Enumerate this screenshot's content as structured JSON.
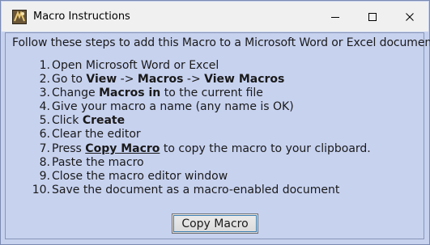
{
  "window": {
    "title": "Macro Instructions"
  },
  "instructions": {
    "intro": "Follow these steps to add this Macro to a Microsoft Word or Excel document:",
    "steps": [
      {
        "num": "1.",
        "parts": [
          {
            "t": "Open Microsoft Word or Excel"
          }
        ]
      },
      {
        "num": "2.",
        "parts": [
          {
            "t": "Go to "
          },
          {
            "t": "View",
            "b": true
          },
          {
            "t": " -> "
          },
          {
            "t": "Macros",
            "b": true
          },
          {
            "t": " -> "
          },
          {
            "t": "View Macros",
            "b": true
          }
        ]
      },
      {
        "num": "3.",
        "parts": [
          {
            "t": "Change "
          },
          {
            "t": "Macros in",
            "b": true
          },
          {
            "t": " to the current file"
          }
        ]
      },
      {
        "num": "4.",
        "parts": [
          {
            "t": "Give your macro a name (any name is OK)"
          }
        ]
      },
      {
        "num": "5.",
        "parts": [
          {
            "t": "Click "
          },
          {
            "t": "Create",
            "b": true
          }
        ]
      },
      {
        "num": "6.",
        "parts": [
          {
            "t": "Clear the editor"
          }
        ]
      },
      {
        "num": "7.",
        "parts": [
          {
            "t": "Press "
          },
          {
            "t": "Copy Macro",
            "b": true,
            "u": true
          },
          {
            "t": " to copy the macro to your clipboard."
          }
        ]
      },
      {
        "num": "8.",
        "parts": [
          {
            "t": "Paste the macro"
          }
        ]
      },
      {
        "num": "9.",
        "parts": [
          {
            "t": "Close the macro editor window"
          }
        ]
      },
      {
        "num": "10.",
        "parts": [
          {
            "t": "Save the document as a macro-enabled document"
          }
        ]
      }
    ]
  },
  "buttons": {
    "copy_macro": "Copy Macro"
  },
  "icons": {
    "app": "macro-app-icon",
    "minimize": "minimize-icon",
    "maximize": "maximize-icon",
    "close": "close-icon"
  },
  "colors": {
    "background": "#c7d2ef",
    "titlebar": "#f0f0f0",
    "button_focus": "#3c7fb1"
  }
}
